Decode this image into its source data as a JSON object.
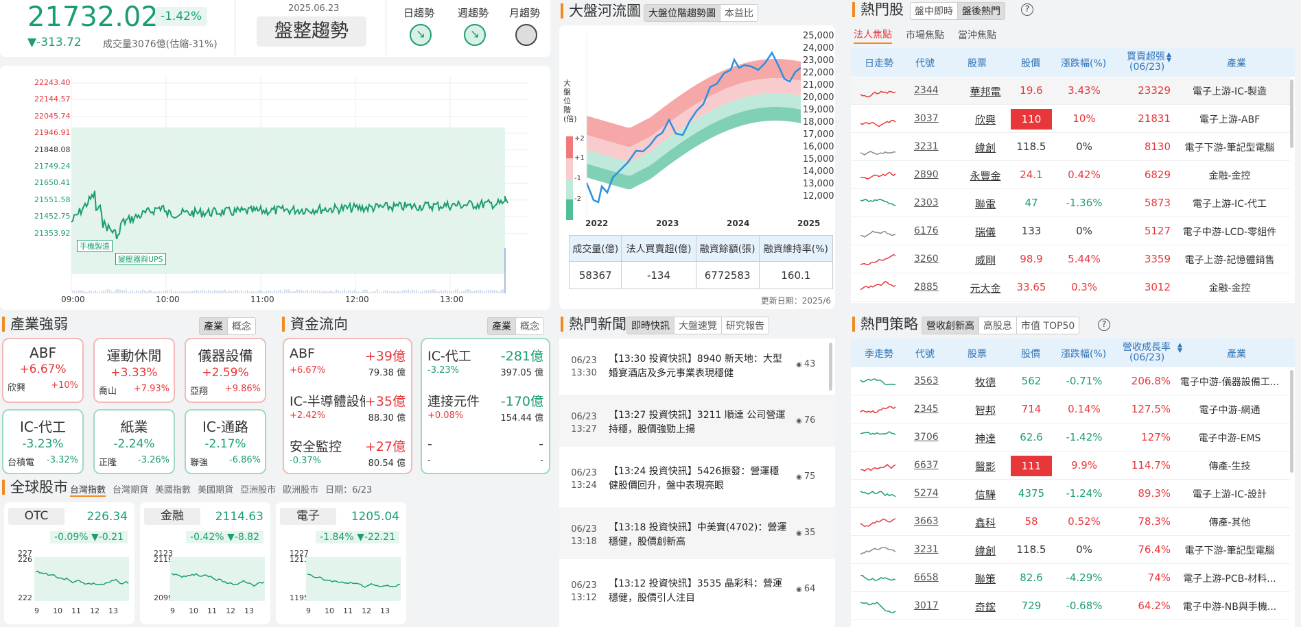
{
  "colors": {
    "red": "#e8373a",
    "green": "#1a9e6e",
    "accent": "#f08a24"
  },
  "index": {
    "value": "21732.02",
    "pct": "-1.42%",
    "change": "▼-313.72",
    "volume": "成交量3076億(估縮-31%)",
    "date": "2025.06.23",
    "trend": "盤整趨勢",
    "day_label": "日趨勢",
    "week_label": "週趨勢",
    "month_label": "月趨勢"
  },
  "intraday": {
    "yticks": [
      "22243.40",
      "22144.57",
      "22045.74",
      "21946.91",
      "21848.08",
      "21749.24",
      "21650.41",
      "21551.58",
      "21452.75",
      "21353.92"
    ],
    "xticks": [
      "09:00",
      "10:00",
      "11:00",
      "12:00",
      "13:00"
    ],
    "tag1": "手機製造",
    "tag2": "變壓器與UPS"
  },
  "river": {
    "title": "大盤河流圖",
    "tabs": [
      "大盤位階趨勢圖",
      "本益比"
    ],
    "side_label": "大盤位階(倍)",
    "levels": [
      "+2",
      "+1",
      "-1",
      "-2"
    ],
    "yticks": [
      "25,000",
      "24,000",
      "23,000",
      "22,000",
      "21,000",
      "20,000",
      "19,000",
      "18,000",
      "17,000",
      "16,000",
      "15,000",
      "14,000",
      "13,000",
      "12,000"
    ],
    "xticks": [
      "2022",
      "2023",
      "2024",
      "2025"
    ],
    "headers": [
      "成交量(億)",
      "法人買賣超(億)",
      "融資餘額(張)",
      "融資維持率(%)"
    ],
    "values": [
      "58367",
      "-134",
      "6772583",
      "160.1"
    ],
    "update": "更新日期：2025/6"
  },
  "hot": {
    "title": "熱門股",
    "tabs": [
      "盤中即時",
      "盤後熱門"
    ],
    "subtabs": [
      "法人焦點",
      "市場焦點",
      "當沖焦點"
    ],
    "headers": [
      "日走勢",
      "代號",
      "股票",
      "股價",
      "漲跌幅(%)",
      "買賣超張",
      "(06/23)",
      "產業"
    ],
    "rows": [
      [
        "2344",
        "華邦電",
        "19.6",
        "3.43%",
        "23329",
        "電子上游-IC-製造",
        "r"
      ],
      [
        "3037",
        "欣興",
        "110",
        "10%",
        "21831",
        "電子上游-ABF",
        "R"
      ],
      [
        "3231",
        "緯創",
        "118.5",
        "0%",
        "8130",
        "電子下游-筆記型電腦",
        "n"
      ],
      [
        "2890",
        "永豐金",
        "24.1",
        "0.42%",
        "6829",
        "金融-金控",
        "r"
      ],
      [
        "2303",
        "聯電",
        "47",
        "-1.36%",
        "5873",
        "電子上游-IC-代工",
        "g"
      ],
      [
        "6176",
        "瑞儀",
        "133",
        "0%",
        "5127",
        "電子中游-LCD-零組件",
        "n"
      ],
      [
        "3260",
        "威剛",
        "98.9",
        "5.44%",
        "3359",
        "電子上游-記憶體銷售",
        "r"
      ],
      [
        "2885",
        "元大金",
        "33.65",
        "0.3%",
        "3012",
        "金融-金控",
        "r"
      ]
    ]
  },
  "sector": {
    "title": "產業強弱",
    "tabs": [
      "產業",
      "概念"
    ],
    "items": [
      [
        "ABF",
        "+6.67%",
        "欣興",
        "+10%",
        "r"
      ],
      [
        "運動休閒",
        "+3.33%",
        "喬山",
        "+7.93%",
        "r"
      ],
      [
        "儀器設備",
        "+2.59%",
        "亞翔",
        "+9.86%",
        "r"
      ],
      [
        "IC-代工",
        "-3.23%",
        "台積電",
        "-3.32%",
        "g"
      ],
      [
        "紙業",
        "-2.24%",
        "正隆",
        "-3.26%",
        "g"
      ],
      [
        "IC-通路",
        "-2.17%",
        "聯強",
        "-6.86%",
        "g"
      ]
    ]
  },
  "funds": {
    "title": "資金流向",
    "tabs": [
      "產業",
      "概念"
    ],
    "red": [
      [
        "ABF",
        "+39億",
        "+6.67%",
        "79.38 億"
      ],
      [
        "IC-半導體設備",
        "+35億",
        "+2.42%",
        "88.30 億"
      ],
      [
        "安全監控",
        "+27億",
        "-0.37%",
        "80.54 億"
      ]
    ],
    "green": [
      [
        "IC-代工",
        "-281億",
        "-3.23%",
        "397.05 億"
      ],
      [
        "連接元件",
        "-170億",
        "+0.08%",
        "154.44 億"
      ],
      [
        "-",
        "-",
        "-",
        "-"
      ]
    ]
  },
  "news": {
    "title": "熱門新聞",
    "tabs": [
      "即時快訊",
      "大盤速覽",
      "研究報告"
    ],
    "items": [
      [
        "06/23",
        "13:30",
        "【13:30 投資快訊】8940 新天地：大型婚宴酒店及多元事業表現穩健",
        "43"
      ],
      [
        "06/23",
        "13:27",
        "【13:27 投資快訊】3211 順達 公司營運持穩，股價強勁上揚",
        "76"
      ],
      [
        "06/23",
        "13:24",
        "【13:24 投資快訊】5426振發：營運穩健股價回升，盤中表現亮眼",
        "75"
      ],
      [
        "06/23",
        "13:18",
        "【13:18 投資快訊】中美實(4702)：營運穩健，股價創新高",
        "35"
      ],
      [
        "06/23",
        "13:12",
        "【13:12 投資快訊】3535 晶彩科：營運穩健，股價引人注目",
        "64"
      ]
    ]
  },
  "strategy": {
    "title": "熱門策略",
    "tabs": [
      "營收創新高",
      "高股息",
      "市值 TOP50"
    ],
    "headers": [
      "季走勢",
      "代號",
      "股票",
      "股價",
      "漲跌幅(%)",
      "營收成長率",
      "(06/23)",
      "產業"
    ],
    "rows": [
      [
        "3563",
        "牧德",
        "562",
        "-0.71%",
        "206.8%",
        "電子中游-儀器設備工...",
        "g"
      ],
      [
        "2345",
        "智邦",
        "714",
        "0.14%",
        "127.5%",
        "電子中游-網通",
        "r"
      ],
      [
        "3706",
        "神達",
        "62.6",
        "-1.42%",
        "127%",
        "電子中游-EMS",
        "g"
      ],
      [
        "6637",
        "醫影",
        "111",
        "9.9%",
        "114.7%",
        "傳產-生技",
        "R"
      ],
      [
        "5274",
        "信驊",
        "4375",
        "-1.24%",
        "89.3%",
        "電子上游-IC-設計",
        "g"
      ],
      [
        "3663",
        "鑫科",
        "58",
        "0.52%",
        "78.3%",
        "傳產-其他",
        "r"
      ],
      [
        "3231",
        "緯創",
        "118.5",
        "0%",
        "76.4%",
        "電子下游-筆記型電腦",
        "n"
      ],
      [
        "6658",
        "聯策",
        "82.6",
        "-4.29%",
        "74%",
        "電子上游-PCB-材料...",
        "g"
      ],
      [
        "3017",
        "奇鋐",
        "729",
        "-0.68%",
        "64.2%",
        "電子中游-NB與手機...",
        "g"
      ]
    ]
  },
  "global": {
    "title": "全球股市",
    "tabs": [
      "台灣指數",
      "台灣期貨",
      "美國指數",
      "美國期貨",
      "亞洲股市",
      "歐洲股市"
    ],
    "date": "日期：6/23",
    "cards": [
      {
        "name": "OTC",
        "price": "226.34",
        "pct": "-0.09%",
        "chg": "▼-0.21",
        "yt": [
          "227",
          "226",
          "222"
        ],
        "xt": [
          "9",
          "10",
          "11",
          "12",
          "13"
        ]
      },
      {
        "name": "金融",
        "price": "2114.63",
        "pct": "-0.42%",
        "chg": "▼-8.82",
        "yt": [
          "2123",
          "2119",
          "2099"
        ],
        "xt": [
          "9",
          "10",
          "11",
          "12",
          "13"
        ]
      },
      {
        "name": "電子",
        "price": "1205.04",
        "pct": "-1.84%",
        "chg": "▼-22.21",
        "yt": [
          "1227",
          "1211",
          "1195"
        ],
        "xt": [
          "9",
          "10",
          "11",
          "12",
          "13"
        ]
      }
    ]
  }
}
